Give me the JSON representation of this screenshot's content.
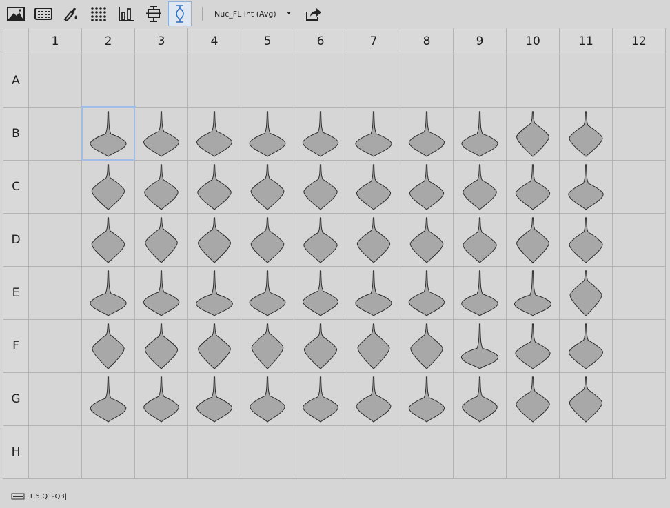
{
  "toolbar": {
    "buttons": [
      {
        "name": "image-view-icon",
        "active": false
      },
      {
        "name": "plate-view-icon",
        "active": false
      },
      {
        "name": "color-dropper-icon",
        "active": false
      },
      {
        "name": "dot-grid-icon",
        "active": false
      },
      {
        "name": "bar-chart-icon",
        "active": false
      },
      {
        "name": "box-plot-icon",
        "active": false
      },
      {
        "name": "violin-plot-icon",
        "active": true
      }
    ],
    "measurement": "Nuc_FL Int (Avg)",
    "export_icon": "export-icon"
  },
  "plate": {
    "columns": [
      "1",
      "2",
      "3",
      "4",
      "5",
      "6",
      "7",
      "8",
      "9",
      "10",
      "11",
      "12"
    ],
    "rows": [
      "A",
      "B",
      "C",
      "D",
      "E",
      "F",
      "G",
      "H"
    ],
    "selected_well": "B2",
    "filled_rows": [
      "B",
      "C",
      "D",
      "E",
      "F",
      "G"
    ],
    "filled_columns": [
      "2",
      "3",
      "4",
      "5",
      "6",
      "7",
      "8",
      "9",
      "10",
      "11"
    ],
    "violin_fill": "#a8a8a8",
    "violin_stroke": "#2a2a2a",
    "selection_color": "#9fbde6"
  },
  "footer": {
    "icon": "whisker-legend-icon",
    "label": "1.5|Q1-Q3|"
  }
}
